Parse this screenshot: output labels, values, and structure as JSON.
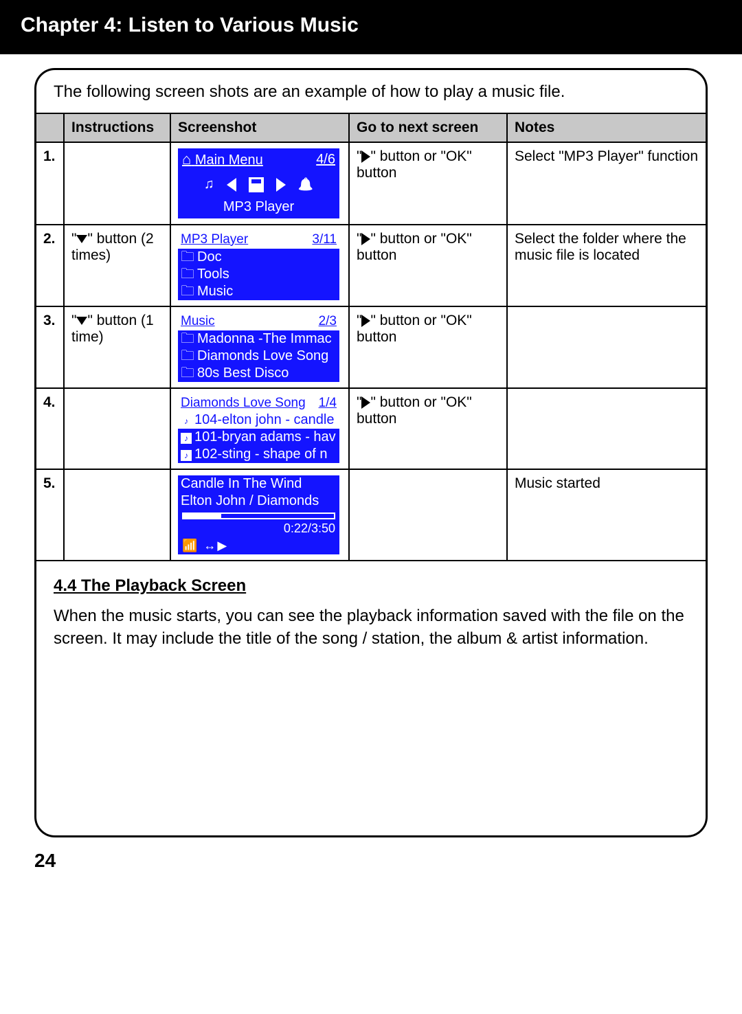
{
  "header": {
    "title": "Chapter 4: Listen to Various Music"
  },
  "intro": "The following screen shots are an example of how to play a music file.",
  "columns": {
    "num": "",
    "instr": "Instructions",
    "shot": "Screenshot",
    "next": "Go to next screen",
    "notes": "Notes"
  },
  "rows": [
    {
      "num": "1.",
      "instr": "",
      "shot": {
        "type": "mainmenu",
        "title_left": "Main Menu",
        "title_right": "4/6",
        "caption": "MP3 Player"
      },
      "next_pre": "\"",
      "next_mid": "\" button or \"OK\" button",
      "notes": "Select \"MP3 Player\" function"
    },
    {
      "num": "2.",
      "instr_pre": "\"",
      "instr_mid": "\" button (2 times)",
      "shot": {
        "type": "list",
        "title_left": "MP3 Player",
        "title_right": "3/11",
        "items": [
          "Doc",
          "Tools",
          "Music"
        ],
        "icon": "folder"
      },
      "next_pre": "\"",
      "next_mid": "\" button or \"OK\" button",
      "notes": "Select the folder where the music file is located"
    },
    {
      "num": "3.",
      "instr_pre": "\"",
      "instr_mid": "\" button (1 time)",
      "shot": {
        "type": "list",
        "title_left": "Music",
        "title_right": "2/3",
        "items": [
          "Madonna -The Immac",
          "Diamonds Love Song",
          "80s Best Disco"
        ],
        "icon": "folder"
      },
      "next_pre": "\"",
      "next_mid": "\" button or \"OK\" button",
      "notes": ""
    },
    {
      "num": "4.",
      "instr": "",
      "shot": {
        "type": "list",
        "title_left": "Diamonds Love Song",
        "title_right": "1/4",
        "items": [
          "104-elton john - candle",
          "101-bryan adams - hav",
          "102-sting - shape of n"
        ],
        "icon": "music",
        "hl": 0
      },
      "next_pre": "\"",
      "next_mid": "\" button or \"OK\" button",
      "notes": ""
    },
    {
      "num": "5.",
      "instr": "",
      "shot": {
        "type": "playback",
        "line1": "Candle In The Wind",
        "line2": "Elton John / Diamonds",
        "time": "0:22/3:50",
        "status": "▏▎▍▋ ↔▶"
      },
      "next": "",
      "notes": "Music started"
    }
  ],
  "section": {
    "heading": "4.4 The Playback Screen",
    "body": "When the music starts, you can see the playback information saved with the file on the screen. It may include the title of the song / station, the album & artist information."
  },
  "page_number": "24"
}
